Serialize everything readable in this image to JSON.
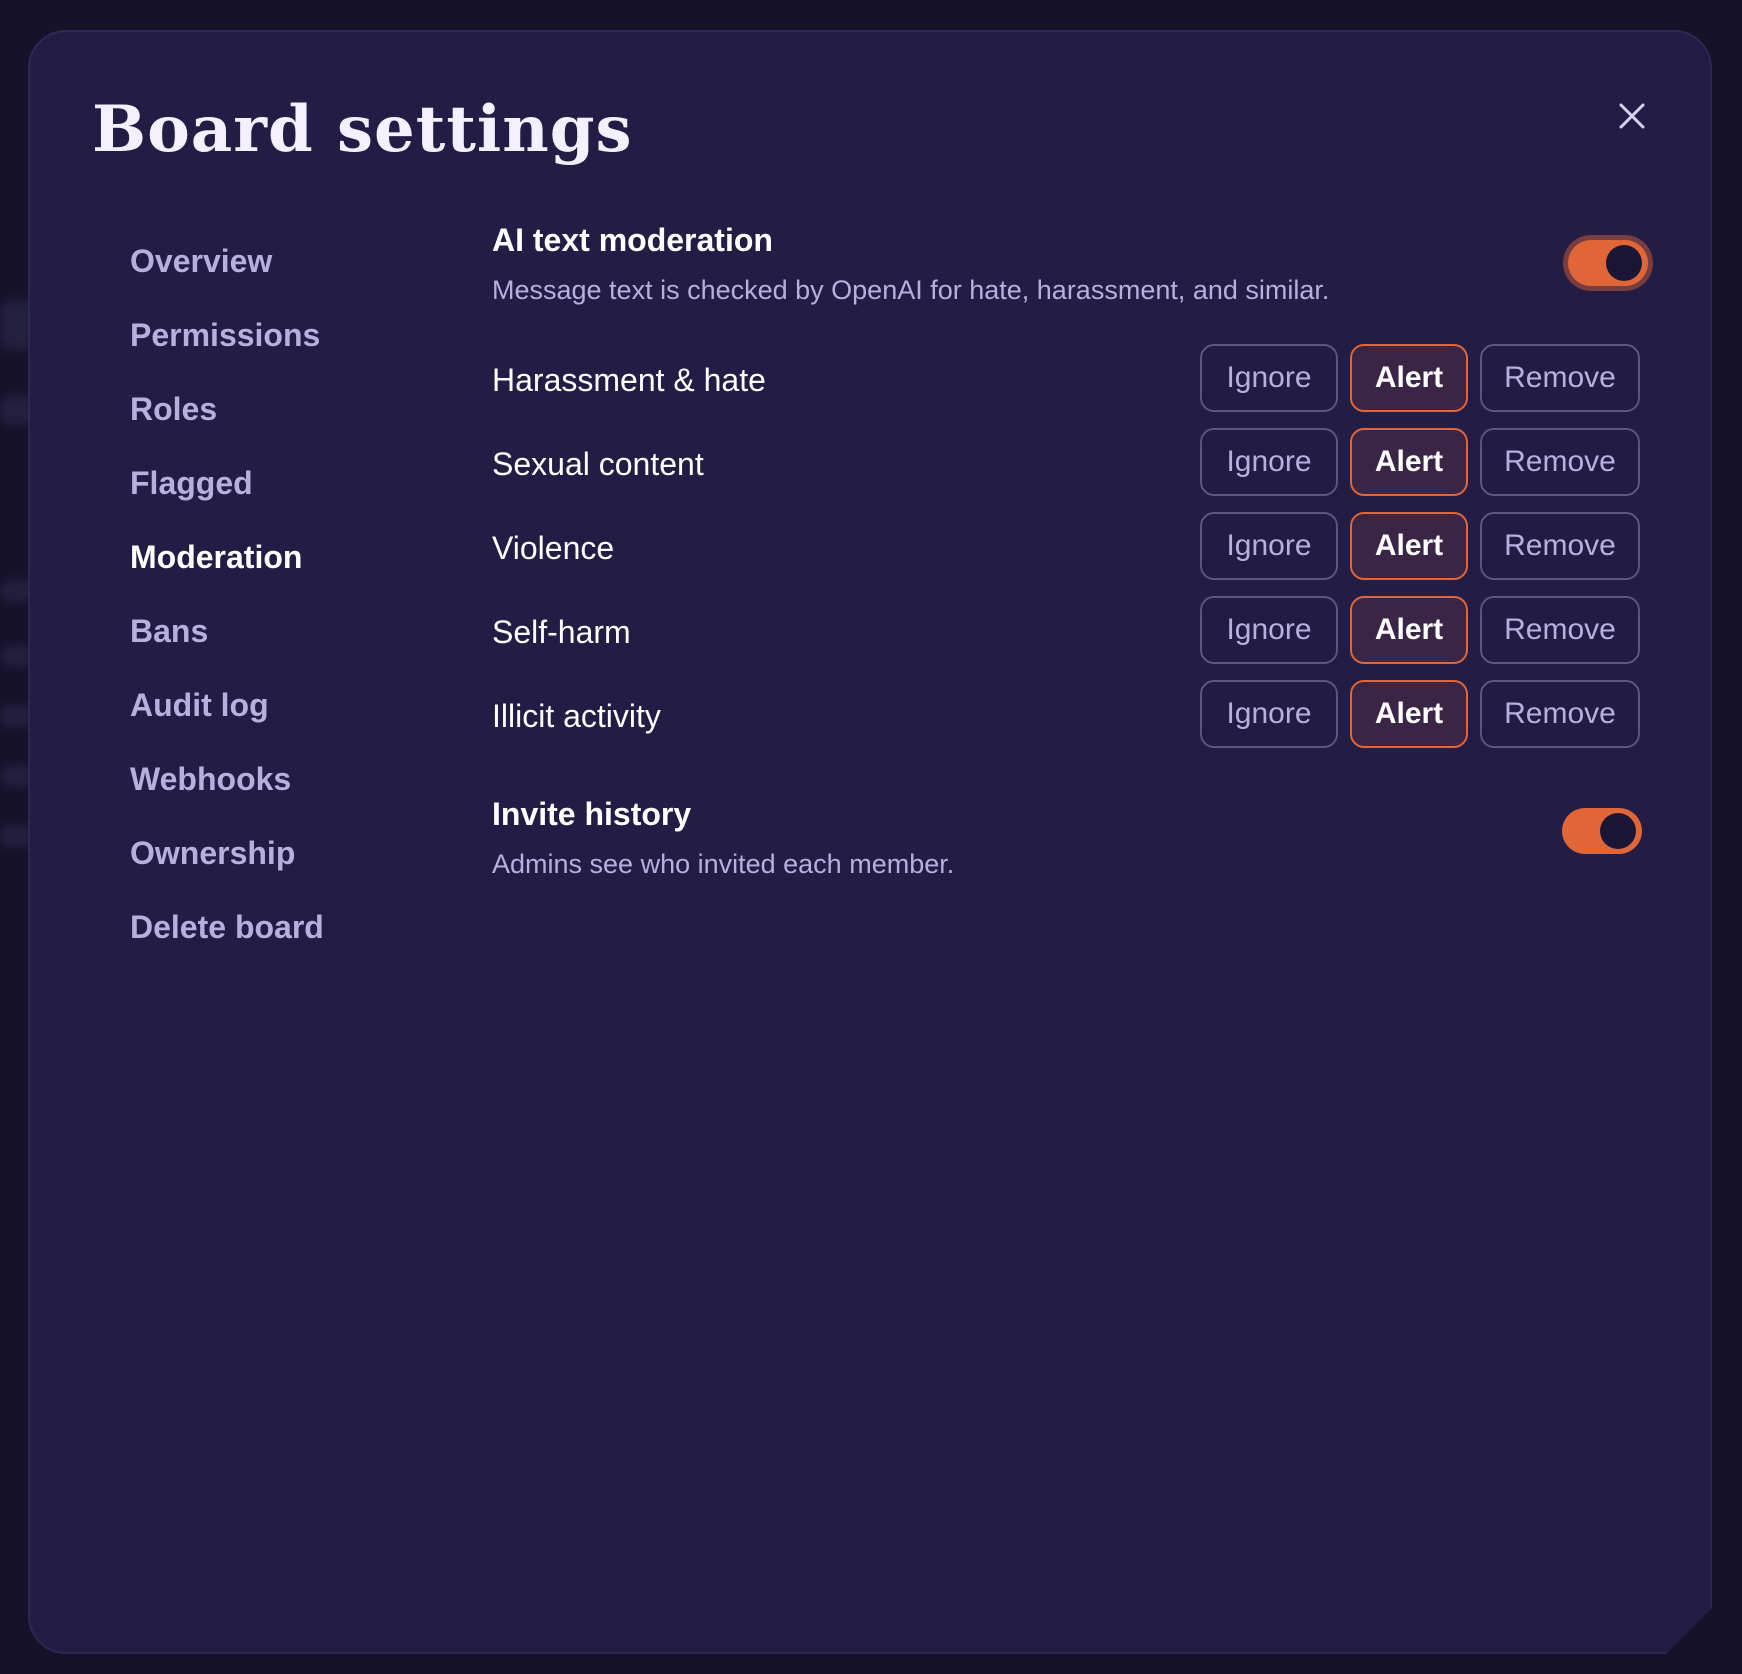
{
  "modal": {
    "title": "Board settings"
  },
  "nav": {
    "items": [
      {
        "label": "Overview"
      },
      {
        "label": "Permissions"
      },
      {
        "label": "Roles"
      },
      {
        "label": "Flagged"
      },
      {
        "label": "Moderation",
        "active": true
      },
      {
        "label": "Bans"
      },
      {
        "label": "Audit log"
      },
      {
        "label": "Webhooks"
      },
      {
        "label": "Ownership"
      },
      {
        "label": "Delete board"
      }
    ]
  },
  "ai_moderation": {
    "title": "AI text moderation",
    "description": "Message text is checked by OpenAI for hate, harassment, and similar.",
    "enabled": true,
    "categories": [
      {
        "label": "Harassment & hate",
        "selected": "Alert"
      },
      {
        "label": "Sexual content",
        "selected": "Alert"
      },
      {
        "label": "Violence",
        "selected": "Alert"
      },
      {
        "label": "Self-harm",
        "selected": "Alert"
      },
      {
        "label": "Illicit activity",
        "selected": "Alert"
      }
    ],
    "options": [
      "Ignore",
      "Alert",
      "Remove"
    ]
  },
  "invite_history": {
    "title": "Invite history",
    "description": "Admins see who invited each member.",
    "enabled": true
  },
  "colors": {
    "accent": "#e06637",
    "modal_bg": "#231c45",
    "muted_text": "#b9afdd"
  },
  "icons": {
    "close": "close-icon"
  }
}
